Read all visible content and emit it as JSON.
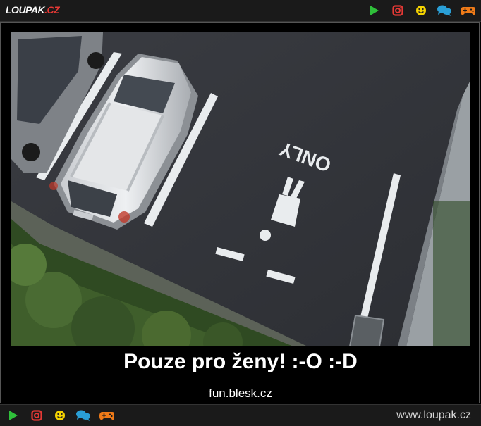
{
  "header": {
    "logo_text": "LOUPAK",
    "logo_suffix": ".CZ",
    "icons": [
      "play-icon",
      "instagram-icon",
      "smiley-icon",
      "chat-icon",
      "gamepad-icon"
    ]
  },
  "post": {
    "image_alt": "Parking space marked ONLY for women",
    "road_text": "ONLY",
    "caption": "Pouze pro ženy! :-O :-D",
    "source": "fun.blesk.cz"
  },
  "footer": {
    "site_url": "www.loupak.cz",
    "icons": [
      "play-icon",
      "instagram-icon",
      "smiley-icon",
      "chat-icon",
      "gamepad-icon"
    ]
  },
  "colors": {
    "play": "#2fbf3a",
    "instagram": "#e53935",
    "smiley": "#f5d300",
    "chat": "#2a9fd6",
    "gamepad": "#f07b18"
  }
}
